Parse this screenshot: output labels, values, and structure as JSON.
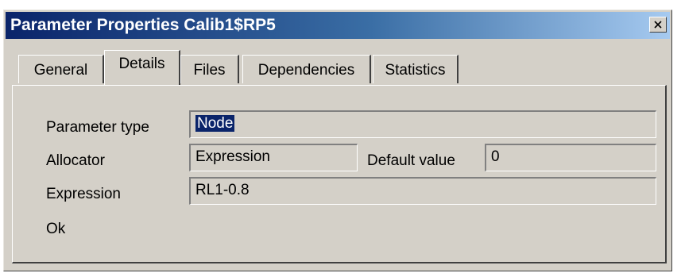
{
  "window": {
    "title": "Parameter Properties Calib1$RP5"
  },
  "tabs": [
    {
      "label": "General",
      "active": false
    },
    {
      "label": "Details",
      "active": true
    },
    {
      "label": "Files",
      "active": false
    },
    {
      "label": "Dependencies",
      "active": false
    },
    {
      "label": "Statistics",
      "active": false
    }
  ],
  "details": {
    "parameter_type_label": "Parameter type",
    "parameter_type_value": "Node",
    "allocator_label": "Allocator",
    "allocator_value": "Expression",
    "default_value_label": "Default value",
    "default_value_value": "0",
    "expression_label": "Expression",
    "expression_value": "RL1-0.8",
    "status_text": "Ok"
  },
  "icons": {
    "close": "close-icon"
  },
  "colors": {
    "titlebar_start": "#0a246a",
    "titlebar_end": "#a6caf0",
    "dialog_face": "#d4d0c8",
    "selection": "#0a246a"
  }
}
